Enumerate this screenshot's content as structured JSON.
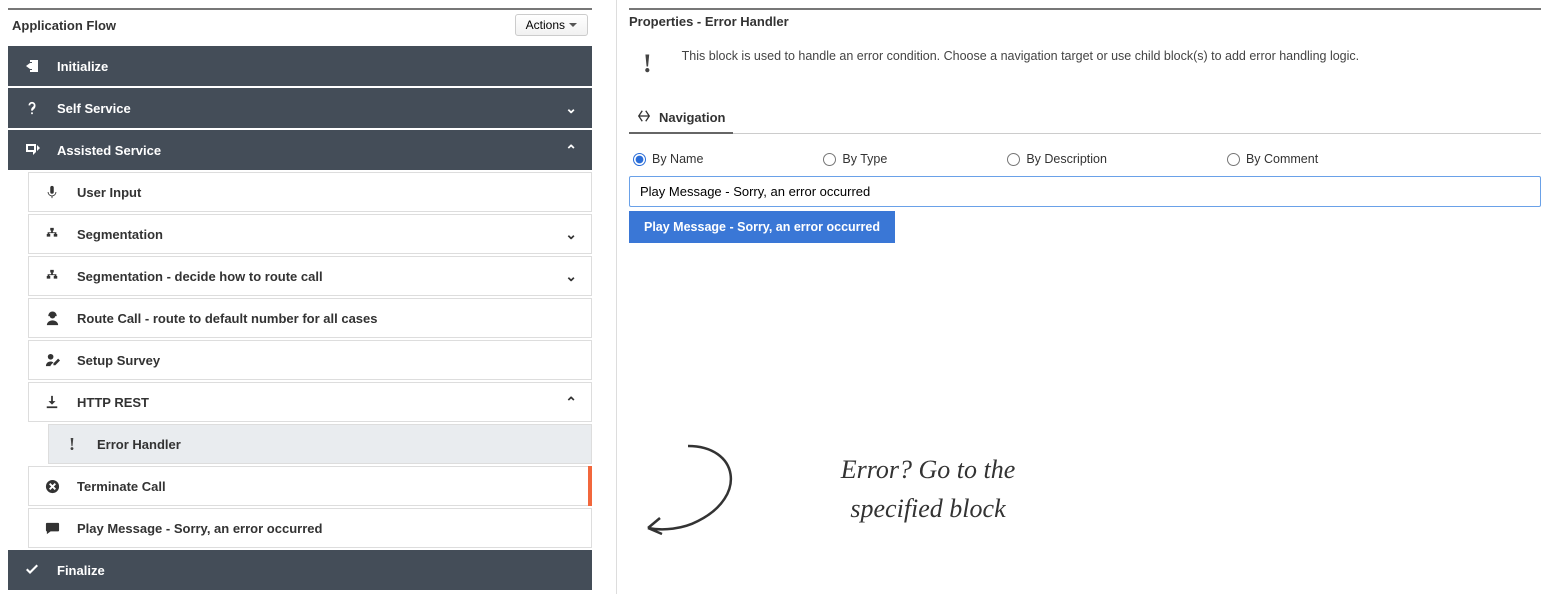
{
  "leftPanel": {
    "title": "Application Flow",
    "actionsLabel": "Actions",
    "items": {
      "initialize": "Initialize",
      "selfService": "Self Service",
      "assistedService": "Assisted Service",
      "userInput": "User Input",
      "segmentation": "Segmentation",
      "segmentationDecide": "Segmentation - decide how to route call",
      "routeCall": "Route Call - route to default number for all cases",
      "setupSurvey": "Setup Survey",
      "httpRest": "HTTP REST",
      "errorHandler": "Error Handler",
      "terminateCall": "Terminate Call",
      "playMessage": "Play Message - Sorry, an error occurred",
      "finalize": "Finalize"
    }
  },
  "rightPanel": {
    "title": "Properties - Error Handler",
    "description": "This block is used to handle an error condition. Choose a navigation target or use child block(s) to add error handling logic.",
    "tabLabel": "Navigation",
    "radios": {
      "byName": "By Name",
      "byType": "By Type",
      "byDescription": "By Description",
      "byComment": "By Comment"
    },
    "searchValue": "Play Message - Sorry, an error occurred",
    "dropdownResult": "Play Message - Sorry, an error occurred"
  },
  "annotation": {
    "line1": "Error? Go to the",
    "line2": "specified block"
  }
}
